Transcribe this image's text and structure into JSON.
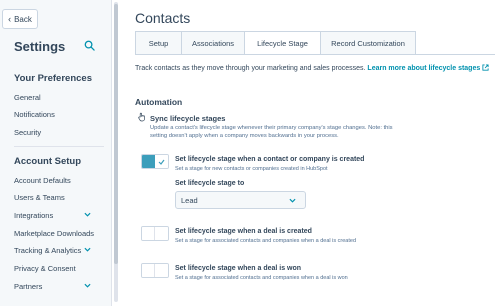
{
  "sidebar": {
    "back_label": "Back",
    "title": "Settings",
    "preferences_heading": "Your Preferences",
    "preferences_items": [
      "General",
      "Notifications",
      "Security"
    ],
    "account_heading": "Account Setup",
    "account_items": [
      {
        "label": "Account Defaults",
        "expandable": false
      },
      {
        "label": "Users & Teams",
        "expandable": false
      },
      {
        "label": "Integrations",
        "expandable": true
      },
      {
        "label": "Marketplace Downloads",
        "expandable": false
      },
      {
        "label": "Tracking & Analytics",
        "expandable": true
      },
      {
        "label": "Privacy & Consent",
        "expandable": false
      },
      {
        "label": "Partners",
        "expandable": true
      }
    ]
  },
  "main": {
    "title": "Contacts",
    "tabs": [
      {
        "label": "Setup",
        "active": false
      },
      {
        "label": "Associations",
        "active": false
      },
      {
        "label": "Lifecycle Stage",
        "active": true
      },
      {
        "label": "Record Customization",
        "active": false
      }
    ],
    "description": "Track contacts as they move through your marketing and sales processes.",
    "learn_more": "Learn more about lifecycle stages",
    "automation_heading": "Automation",
    "sync": {
      "title": "Sync lifecycle stages",
      "description": "Update a contact's lifecycle stage whenever their primary company's stage changes. Note: this setting doesn't apply when a company moves backwards in your process."
    },
    "options": [
      {
        "title": "Set lifecycle stage when a contact or company is created",
        "description": "Set a stage for new contacts or companies created in HubSpot",
        "enabled": true
      },
      {
        "title": "Set lifecycle stage when a deal is created",
        "description": "Set a stage for associated contacts and companies when a deal is created",
        "enabled": false
      },
      {
        "title": "Set lifecycle stage when a deal is won",
        "description": "Set a stage for associated contacts and companies when a deal is won",
        "enabled": false
      }
    ],
    "stage_select": {
      "label": "Set lifecycle stage to",
      "value": "Lead"
    }
  },
  "colors": {
    "accent": "#0091ae",
    "toggle_on": "#3c9ebb",
    "text": "#33475b",
    "sidebar_bg": "#f5f8fa"
  }
}
